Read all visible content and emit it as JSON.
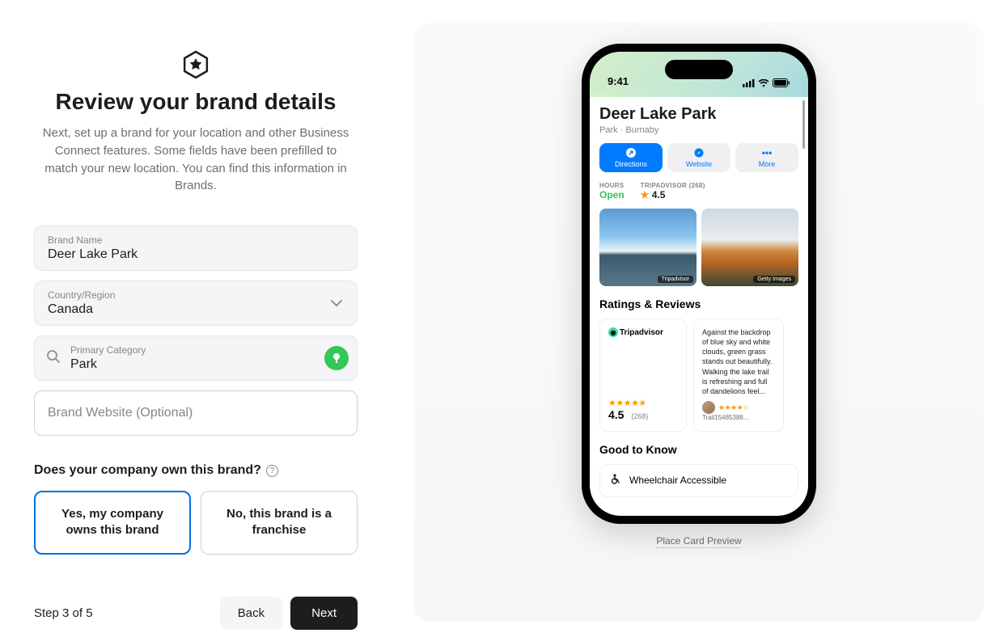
{
  "header": {
    "title": "Review your brand details",
    "subtitle": "Next, set up a brand for your location and other Business Connect features. Some fields have been prefilled to match your new location. You can find this information in Brands."
  },
  "form": {
    "brand_name_label": "Brand Name",
    "brand_name_value": "Deer Lake Park",
    "country_label": "Country/Region",
    "country_value": "Canada",
    "category_label": "Primary Category",
    "category_value": "Park",
    "website_placeholder": "Brand Website (Optional)"
  },
  "ownership": {
    "question": "Does your company own this brand?",
    "option_yes": "Yes, my company owns this brand",
    "option_no": "No, this brand is a franchise"
  },
  "nav": {
    "step_label": "Step 3 of 5",
    "back_label": "Back",
    "next_label": "Next"
  },
  "preview": {
    "status_time": "9:41",
    "place_title": "Deer Lake Park",
    "place_subtitle": "Park · Burnaby",
    "actions": {
      "directions": "Directions",
      "website": "Website",
      "more": "More"
    },
    "hours_label": "HOURS",
    "hours_value": "Open",
    "rating_label": "TRIPADVISOR (268)",
    "rating_value": "4.5",
    "thumb1_source": "Tripadvisor",
    "thumb2_source": "Getty Images",
    "ratings_section": "Ratings & Reviews",
    "trip_name": "Tripadvisor",
    "summary_rating": "4.5",
    "summary_count": "(268)",
    "review_text": "Against the backdrop of blue sky and white clouds, green grass stands out beautifully. Walking the lake trail is refreshing and full of dandelions feel...",
    "review_author": "Trail15485388...",
    "gtk_section": "Good to Know",
    "gtk_item": "Wheelchair Accessible",
    "caption": "Place Card Preview"
  }
}
